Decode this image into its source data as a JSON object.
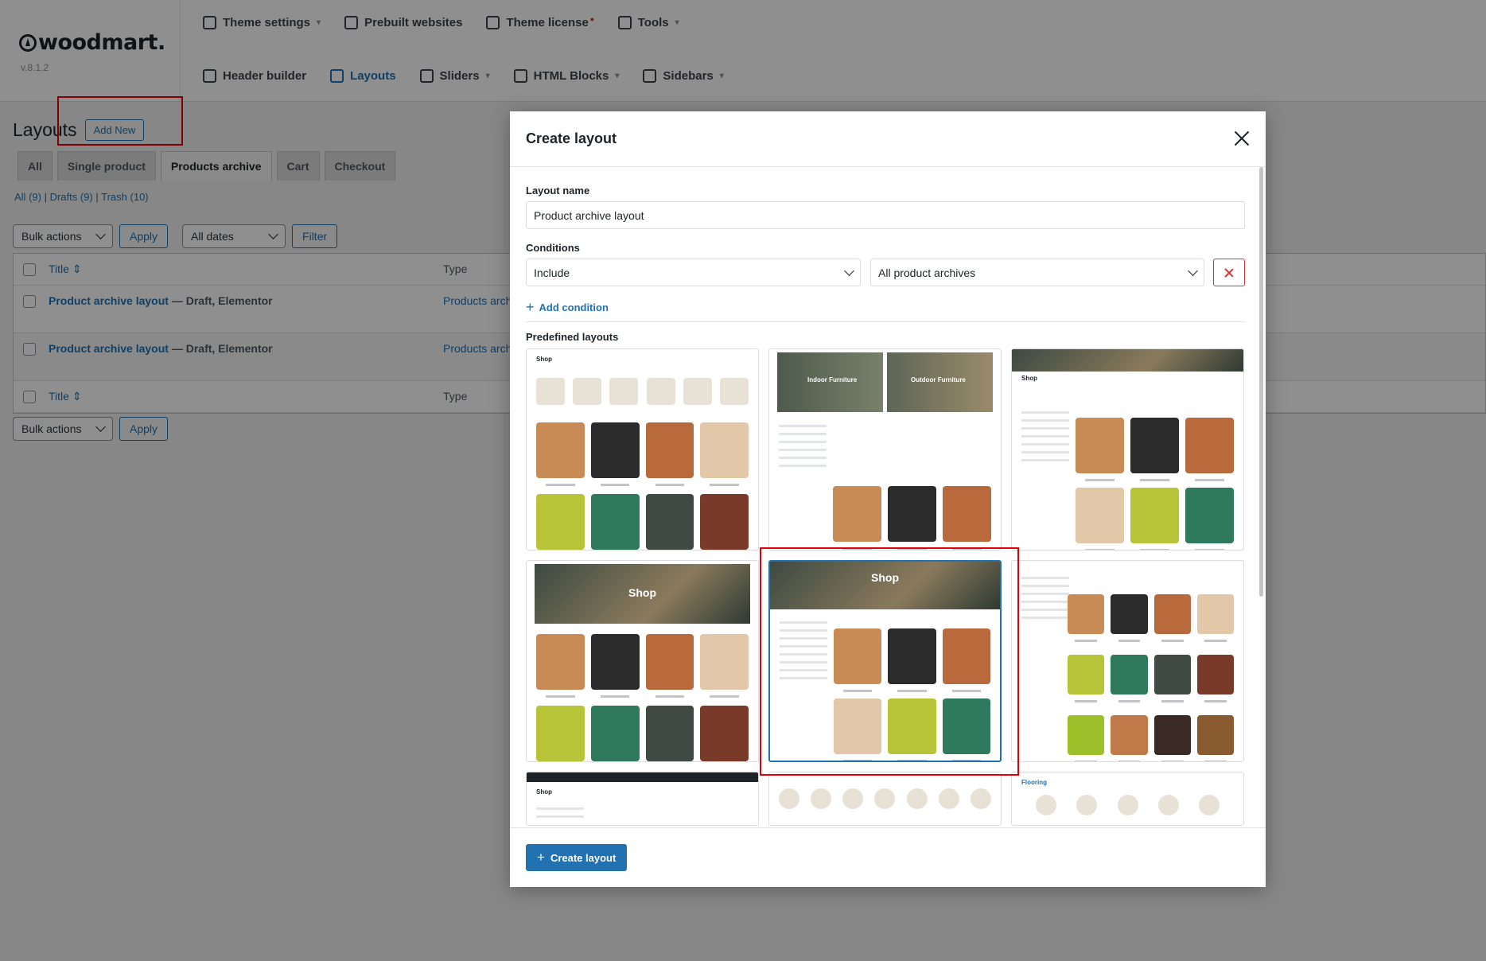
{
  "brand": {
    "name": "woodmart.",
    "version": "v.8.1.2"
  },
  "nav_top": [
    {
      "label": "Theme settings",
      "caret": true
    },
    {
      "label": "Prebuilt websites",
      "caret": false
    },
    {
      "label": "Theme license",
      "caret": false
    },
    {
      "label": "Tools",
      "caret": true
    }
  ],
  "nav_bottom": [
    {
      "label": "Header builder",
      "active": false
    },
    {
      "label": "Layouts",
      "active": true
    },
    {
      "label": "Sliders",
      "active": false
    },
    {
      "label": "HTML Blocks",
      "active": false
    },
    {
      "label": "Sidebars",
      "active": false
    }
  ],
  "page": {
    "title": "Layouts",
    "add_new": "Add New",
    "tabs": [
      "All",
      "Single product",
      "Products archive",
      "Cart",
      "Checkout"
    ],
    "active_tab": "Products archive",
    "views": {
      "all": "All",
      "all_count": "(9)",
      "drafts": "Drafts",
      "drafts_count": "(9)",
      "trash": "Trash",
      "trash_count": "(10)"
    },
    "bulk_actions": "Bulk actions",
    "apply": "Apply",
    "all_dates": "All dates",
    "filter": "Filter"
  },
  "table": {
    "col_title": "Title",
    "col_type": "Type",
    "rows": [
      {
        "title": "Product archive layout",
        "state": "— Draft, Elementor",
        "type": "Products arch"
      },
      {
        "title": "Product archive layout",
        "state": "— Draft, Elementor",
        "type": "Products arch"
      }
    ]
  },
  "modal": {
    "title": "Create layout",
    "layout_name_label": "Layout name",
    "layout_name_value": "Product archive layout",
    "conditions_label": "Conditions",
    "condition_type": "Include",
    "condition_value": "All product archives",
    "add_condition": "Add condition",
    "predefined_label": "Predefined layouts",
    "create_button": "Create layout",
    "cards": [
      {
        "id": 1,
        "heading": "Shop",
        "variant": "plain"
      },
      {
        "id": 2,
        "heading": "",
        "variant": "split",
        "left_label": "Indoor Furniture",
        "right_label": "Outdoor Furniture"
      },
      {
        "id": 3,
        "heading": "Shop",
        "variant": "hero-sidebar"
      },
      {
        "id": 4,
        "heading": "Shop",
        "variant": "hero"
      },
      {
        "id": 5,
        "heading": "Shop",
        "variant": "hero-selected",
        "selected": true
      },
      {
        "id": 6,
        "heading": "",
        "variant": "sidebar"
      },
      {
        "id": 7,
        "heading": "Shop",
        "variant": "dark-top"
      },
      {
        "id": 8,
        "heading": "",
        "variant": "categories"
      },
      {
        "id": 9,
        "heading": "Flooring",
        "variant": "categories2"
      }
    ]
  },
  "colors": {
    "accent": "#2271b1",
    "danger": "#d63638",
    "highlight": "#e0000a"
  }
}
